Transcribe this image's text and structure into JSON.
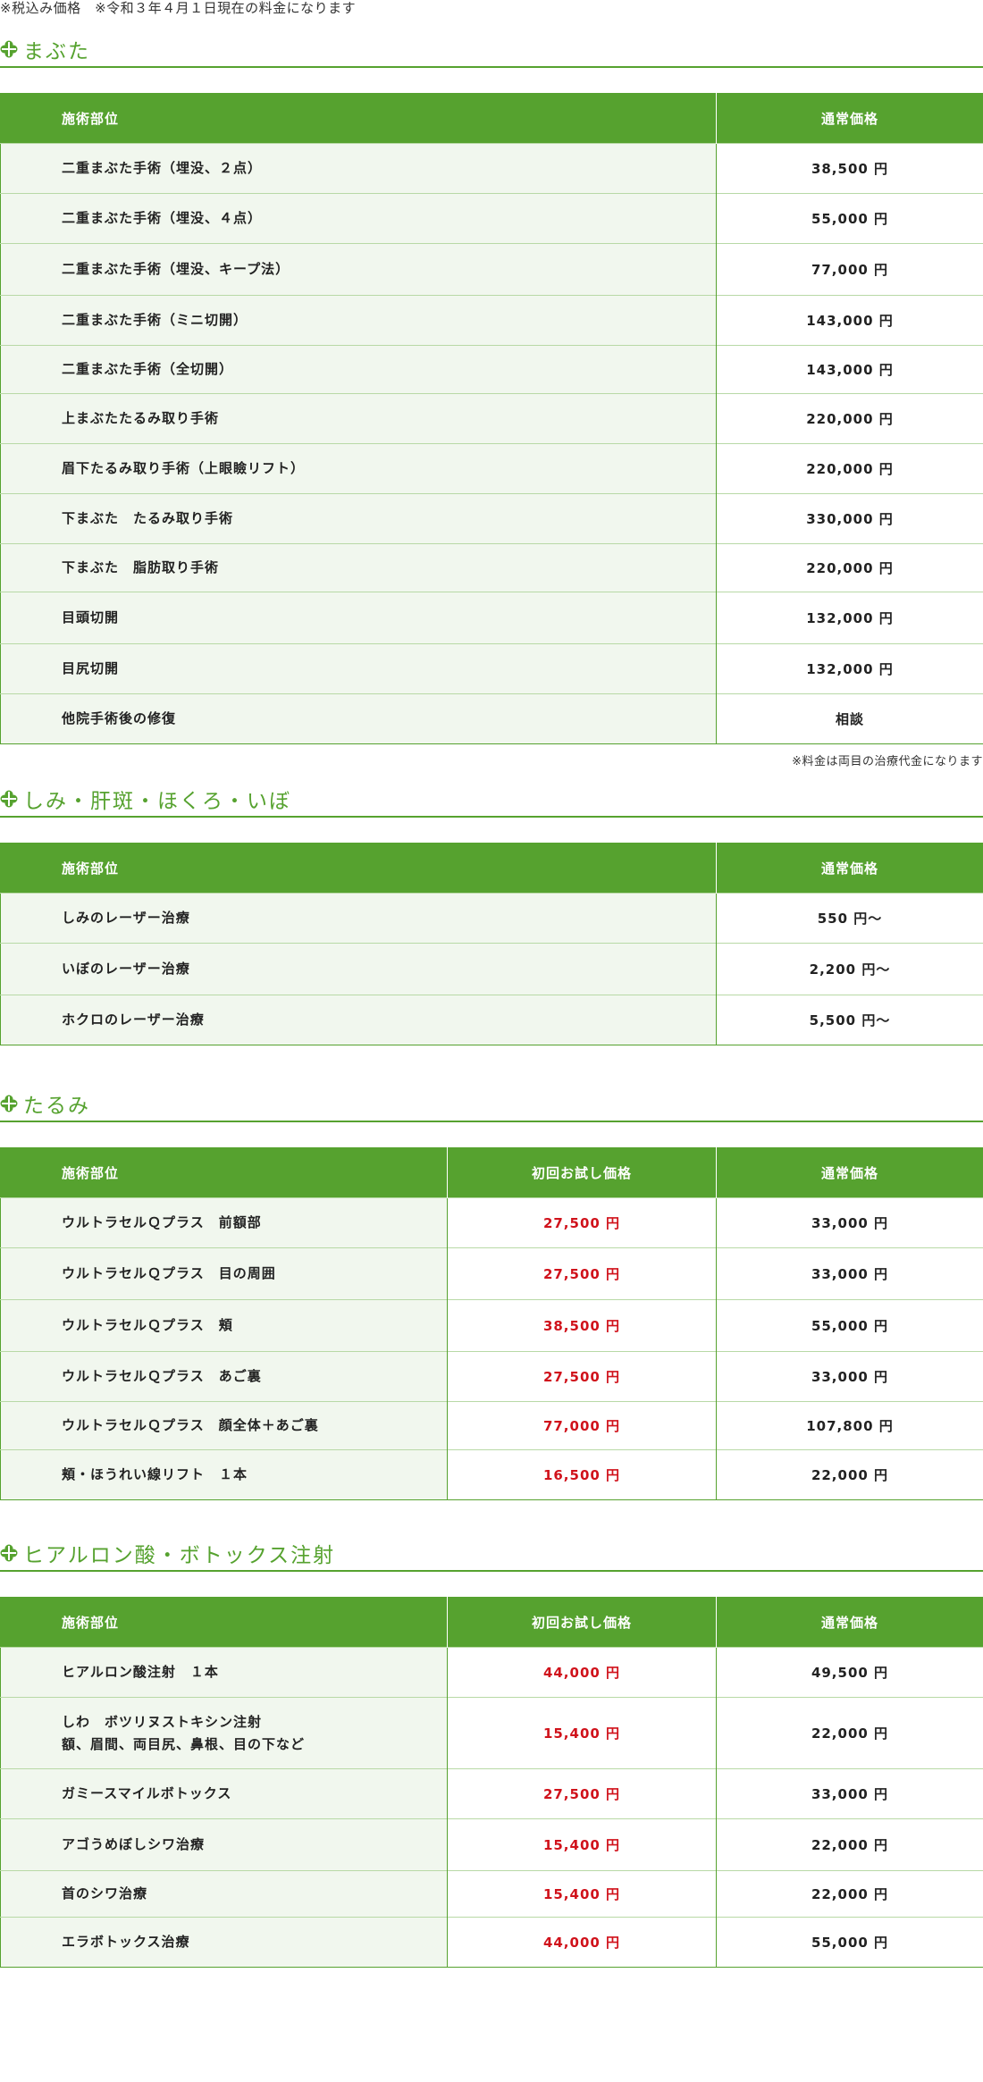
{
  "top_note": "※税込み価格　※令和３年４月１日現在の料金になります",
  "sections": [
    {
      "title": "まぶた",
      "headers": [
        "施術部位",
        "通常価格"
      ],
      "rows": [
        {
          "item": "二重まぶた手術（埋没、２点）",
          "price": "38,500 円"
        },
        {
          "item": "二重まぶた手術（埋没、４点）",
          "price": "55,000 円"
        },
        {
          "item": "二重まぶた手術（埋没、キープ法）",
          "price": "77,000 円"
        },
        {
          "item": "二重まぶた手術（ミニ切開）",
          "price": "143,000 円"
        },
        {
          "item": "二重まぶた手術（全切開）",
          "price": "143,000 円"
        },
        {
          "item": "上まぶたたるみ取り手術",
          "price": "220,000 円"
        },
        {
          "item": "眉下たるみ取り手術（上眼瞼リフト）",
          "price": "220,000 円"
        },
        {
          "item": "下まぶた　たるみ取り手術",
          "price": "330,000 円"
        },
        {
          "item": "下まぶた　脂肪取り手術",
          "price": "220,000 円"
        },
        {
          "item": "目頭切開",
          "price": "132,000 円"
        },
        {
          "item": "目尻切開",
          "price": "132,000 円"
        },
        {
          "item": "他院手術後の修復",
          "price": "相談"
        }
      ],
      "note": "※料金は両目の治療代金になります"
    },
    {
      "title": "しみ・肝斑・ほくろ・いぼ",
      "headers": [
        "施術部位",
        "通常価格"
      ],
      "rows": [
        {
          "item": "しみのレーザー治療",
          "price": "550 円〜"
        },
        {
          "item": "いぼのレーザー治療",
          "price": "2,200 円〜"
        },
        {
          "item": "ホクロのレーザー治療",
          "price": "5,500 円〜"
        }
      ]
    },
    {
      "title": "たるみ",
      "headers": [
        "施術部位",
        "初回お試し価格",
        "通常価格"
      ],
      "rows": [
        {
          "item": "ウルトラセルＱプラス　前額部",
          "trial": "27,500 円",
          "price": "33,000 円"
        },
        {
          "item": "ウルトラセルＱプラス　目の周囲",
          "trial": "27,500 円",
          "price": "33,000 円"
        },
        {
          "item": "ウルトラセルＱプラス　頬",
          "trial": "38,500 円",
          "price": "55,000 円"
        },
        {
          "item": "ウルトラセルＱプラス　あご裏",
          "trial": "27,500 円",
          "price": "33,000 円"
        },
        {
          "item": "ウルトラセルＱプラス　顔全体＋あご裏",
          "trial": "77,000 円",
          "price": "107,800 円"
        },
        {
          "item": "頬・ほうれい線リフト　１本",
          "trial": "16,500 円",
          "price": "22,000 円"
        }
      ]
    },
    {
      "title": "ヒアルロン酸・ボトックス注射",
      "headers": [
        "施術部位",
        "初回お試し価格",
        "通常価格"
      ],
      "rows": [
        {
          "item": "ヒアルロン酸注射　１本",
          "trial": "44,000 円",
          "price": "49,500 円"
        },
        {
          "item": "しわ　ボツリヌストキシン注射",
          "item2": "額、眉間、両目尻、鼻根、目の下など",
          "trial": "15,400 円",
          "price": "22,000 円"
        },
        {
          "item": "ガミースマイルボトックス",
          "trial": "27,500 円",
          "price": "33,000 円"
        },
        {
          "item": "アゴうめぼしシワ治療",
          "trial": "15,400 円",
          "price": "22,000 円"
        },
        {
          "item": "首のシワ治療",
          "trial": "15,400 円",
          "price": "22,000 円"
        },
        {
          "item": "エラボトックス治療",
          "trial": "44,000 円",
          "price": "55,000 円"
        }
      ]
    }
  ],
  "colors": {
    "accent": "#56a22f",
    "trial_price": "#d0121b",
    "row_bg": "#f1f7ee"
  },
  "icons": {
    "section_icon": "green-clover-cross-icon"
  }
}
